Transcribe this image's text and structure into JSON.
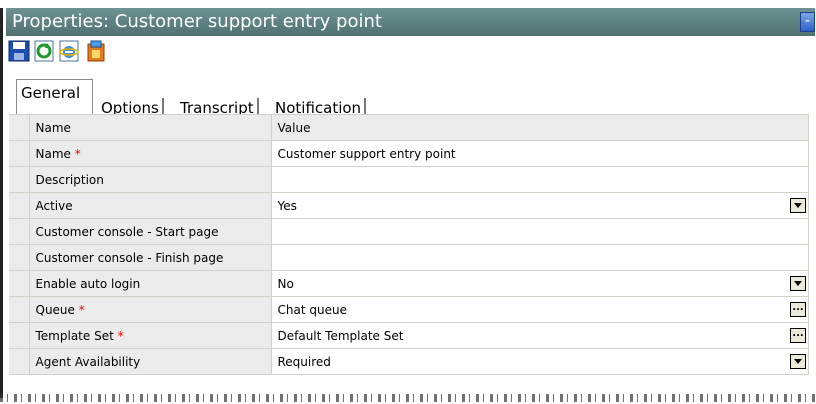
{
  "window": {
    "title": "Properties: Customer support entry point",
    "title_button_glyph": "-"
  },
  "toolbar": {
    "buttons": [
      {
        "icon": "save-icon"
      },
      {
        "icon": "refresh-icon"
      },
      {
        "icon": "internet-explorer-icon"
      },
      {
        "icon": "wizard-icon"
      }
    ]
  },
  "tabs": [
    {
      "label": "General",
      "active": true
    },
    {
      "label": "Options",
      "active": false
    },
    {
      "label": "Transcript",
      "active": false
    },
    {
      "label": "Notification",
      "active": false
    }
  ],
  "grid": {
    "headers": {
      "name": "Name",
      "value": "Value"
    },
    "rows": [
      {
        "name": "Name",
        "required": true,
        "value": "Customer support entry point",
        "control": "none"
      },
      {
        "name": "Description",
        "required": false,
        "value": "",
        "control": "none"
      },
      {
        "name": "Active",
        "required": false,
        "value": "Yes",
        "control": "dropdown"
      },
      {
        "name": "Customer console - Start page",
        "required": false,
        "value": "",
        "control": "none"
      },
      {
        "name": "Customer console - Finish page",
        "required": false,
        "value": "",
        "control": "none"
      },
      {
        "name": "Enable auto login",
        "required": false,
        "value": "No",
        "control": "dropdown"
      },
      {
        "name": "Queue",
        "required": true,
        "value": "Chat queue",
        "control": "ellipsis"
      },
      {
        "name": "Template Set",
        "required": true,
        "value": "Default Template Set",
        "control": "ellipsis"
      },
      {
        "name": "Agent Availability",
        "required": false,
        "value": "Required",
        "control": "dropdown"
      }
    ],
    "required_marker": "*",
    "ellipsis_glyph": "..."
  },
  "colors": {
    "titlebar": "#5f8282",
    "header_bg": "#ebebeb",
    "required": "#ff0000"
  }
}
